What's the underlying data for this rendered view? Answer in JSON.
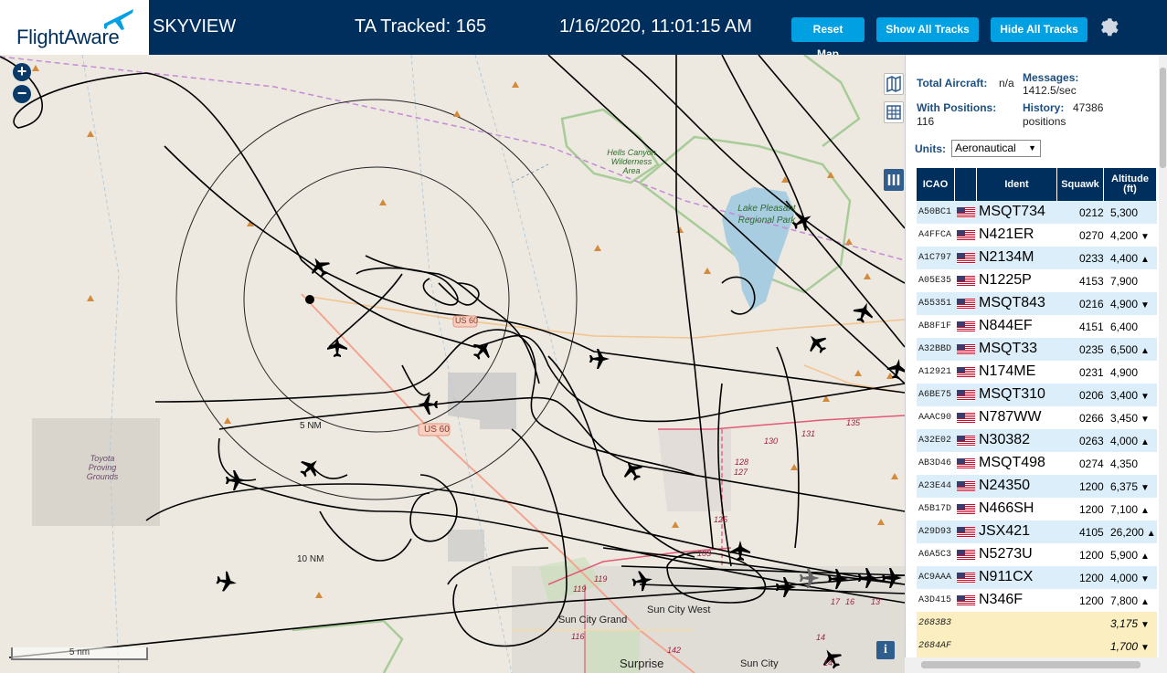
{
  "header": {
    "logo": "FlightAware",
    "title": "SKYVIEW",
    "tracked": "TA Tracked: 165",
    "datetime": "1/16/2020, 11:01:15 AM",
    "buttons": {
      "reset": "Reset Map",
      "show_all": "Show All Tracks",
      "hide_all": "Hide All Tracks"
    },
    "icons": {
      "settings": "gear-icon",
      "logo": "plane-icon"
    }
  },
  "map": {
    "zoom_in": "+",
    "zoom_out": "−",
    "scale_label": "5 nm",
    "info": "i",
    "ring_labels": [
      "5 NM",
      "10 NM"
    ],
    "place_labels": {
      "hells_canyon": "Hells Canyon Wilderness Area",
      "lake_pleasant": "Lake Pleasant Regional Park",
      "toyota": "Toyota Proving Grounds",
      "sun_city_west": "Sun City West",
      "sun_city_grand": "Sun City Grand",
      "surprise": "Surprise",
      "sun_city": "Sun City"
    },
    "road_labels": [
      "US 60",
      "US 60",
      "130",
      "131",
      "135",
      "128",
      "127",
      "125",
      "119",
      "119",
      "116",
      "142",
      "103",
      "17",
      "16",
      "14",
      "14",
      "13"
    ],
    "tools": [
      "map-icon",
      "grid-icon",
      "columns-icon"
    ]
  },
  "panel": {
    "total_aircraft_label": "Total Aircraft:",
    "total_aircraft_value": "n/a",
    "messages_label": "Messages:",
    "messages_value": "1412.5/sec",
    "with_positions_label": "With Positions:",
    "with_positions_value": "116",
    "history_label": "History:",
    "history_value": "47386 positions",
    "units_label": "Units:",
    "units_value": "Aeronautical",
    "columns": [
      "ICAO",
      "",
      "Ident",
      "Squawk",
      "Altitude (ft)"
    ],
    "rows": [
      {
        "icao": "A50BC1",
        "ident": "MSQT734",
        "squawk": "0212",
        "alt": "5,300",
        "trend": ""
      },
      {
        "icao": "A4FFCA",
        "ident": "N421ER",
        "squawk": "0270",
        "alt": "4,200",
        "trend": "▼"
      },
      {
        "icao": "A1C797",
        "ident": "N2134M",
        "squawk": "0233",
        "alt": "4,400",
        "trend": "▲"
      },
      {
        "icao": "A05E35",
        "ident": "N1225P",
        "squawk": "4153",
        "alt": "7,900",
        "trend": ""
      },
      {
        "icao": "A55351",
        "ident": "MSQT843",
        "squawk": "0216",
        "alt": "4,900",
        "trend": "▼"
      },
      {
        "icao": "AB8F1F",
        "ident": "N844EF",
        "squawk": "4151",
        "alt": "6,400",
        "trend": ""
      },
      {
        "icao": "A32BBD",
        "ident": "MSQT33",
        "squawk": "0235",
        "alt": "6,500",
        "trend": "▲"
      },
      {
        "icao": "A12921",
        "ident": "N174ME",
        "squawk": "0231",
        "alt": "4,900",
        "trend": ""
      },
      {
        "icao": "A6BE75",
        "ident": "MSQT310",
        "squawk": "0206",
        "alt": "3,400",
        "trend": "▼"
      },
      {
        "icao": "AAAC90",
        "ident": "N787WW",
        "squawk": "0266",
        "alt": "3,450",
        "trend": "▼"
      },
      {
        "icao": "A32E02",
        "ident": "N30382",
        "squawk": "0263",
        "alt": "4,000",
        "trend": "▲"
      },
      {
        "icao": "AB3D46",
        "ident": "MSQT498",
        "squawk": "0274",
        "alt": "4,350",
        "trend": ""
      },
      {
        "icao": "A23E44",
        "ident": "N24350",
        "squawk": "1200",
        "alt": "6,375",
        "trend": "▼"
      },
      {
        "icao": "A5B17D",
        "ident": "N466SH",
        "squawk": "1200",
        "alt": "7,100",
        "trend": "▲"
      },
      {
        "icao": "A29D93",
        "ident": "JSX421",
        "squawk": "4105",
        "alt": "26,200",
        "trend": "▲"
      },
      {
        "icao": "A6A5C3",
        "ident": "N5273U",
        "squawk": "1200",
        "alt": "5,900",
        "trend": "▲"
      },
      {
        "icao": "AC9AAA",
        "ident": "N911CX",
        "squawk": "1200",
        "alt": "4,000",
        "trend": "▼"
      },
      {
        "icao": "A3D415",
        "ident": "N346F",
        "squawk": "1200",
        "alt": "7,800",
        "trend": "▲"
      },
      {
        "icao": "2683B3",
        "ident": "",
        "squawk": "",
        "alt": "3,175",
        "trend": "▼",
        "other": true
      },
      {
        "icao": "2684AF",
        "ident": "",
        "squawk": "",
        "alt": "1,700",
        "trend": "▼",
        "other": true
      }
    ]
  },
  "colors": {
    "header_bg": "#002f5d",
    "button_bg": "#00a0e2",
    "row_even": "#dbeef9",
    "row_other": "#fbefc2"
  }
}
